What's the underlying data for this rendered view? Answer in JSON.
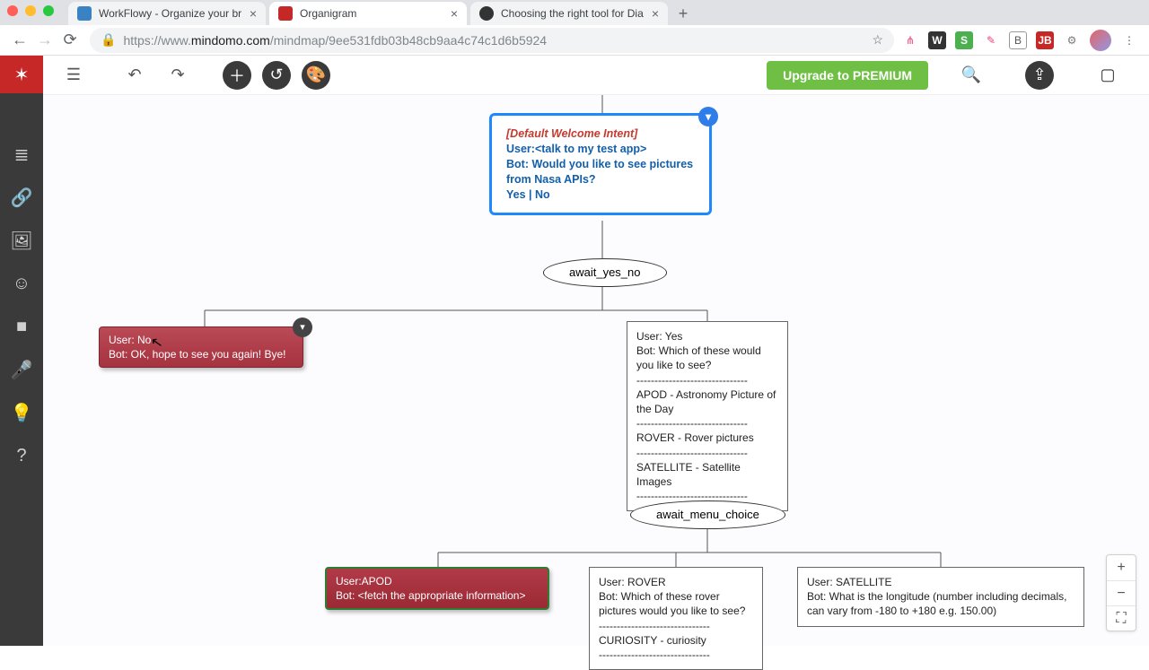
{
  "browser": {
    "tabs": [
      {
        "title": "WorkFlowy - Organize your br",
        "active": false,
        "fav": "#3b82c4"
      },
      {
        "title": "Organigram",
        "active": true,
        "fav": "#c62828"
      },
      {
        "title": "Choosing the right tool for Dia",
        "active": false,
        "fav": "#333"
      }
    ],
    "url_host_prefix": "https://www.",
    "url_host": "mindomo.com",
    "url_path": "/mindmap/9ee531fdb03b48cb9aa4c74c1d6b5924"
  },
  "appbar": {
    "premium": "Upgrade to PREMIUM"
  },
  "diagram": {
    "root": {
      "intent": "[Default Welcome Intent]",
      "user": "User:<talk to my test app>",
      "bot": "Bot: Would you like to see pictures from Nasa APIs?",
      "opts": "Yes | No"
    },
    "await1": "await_yes_no",
    "no_node": {
      "l1": "User: No",
      "l2": "Bot: OK, hope to see you again! Bye!"
    },
    "yes_node": {
      "l1": "User: Yes",
      "l2": "Bot: Which of these would you like to see?",
      "dash": "-------------------------------",
      "i1": "APOD - Astronomy Picture of the Day",
      "i2": "ROVER - Rover pictures",
      "i3": "SATELLITE - Satellite Images"
    },
    "await2": "await_menu_choice",
    "apod": {
      "l1": "User:APOD",
      "l2": "Bot: <fetch the appropriate information>"
    },
    "rover": {
      "l1": "User: ROVER",
      "l2": "Bot: Which of these rover pictures would you like to see?",
      "dash": "-------------------------------",
      "i1": "CURIOSITY - curiosity"
    },
    "sat": {
      "l1": "User: SATELLITE",
      "l2": "Bot: What is the longitude (number including decimals, can vary from -180 to +180 e.g. 150.00)"
    }
  }
}
